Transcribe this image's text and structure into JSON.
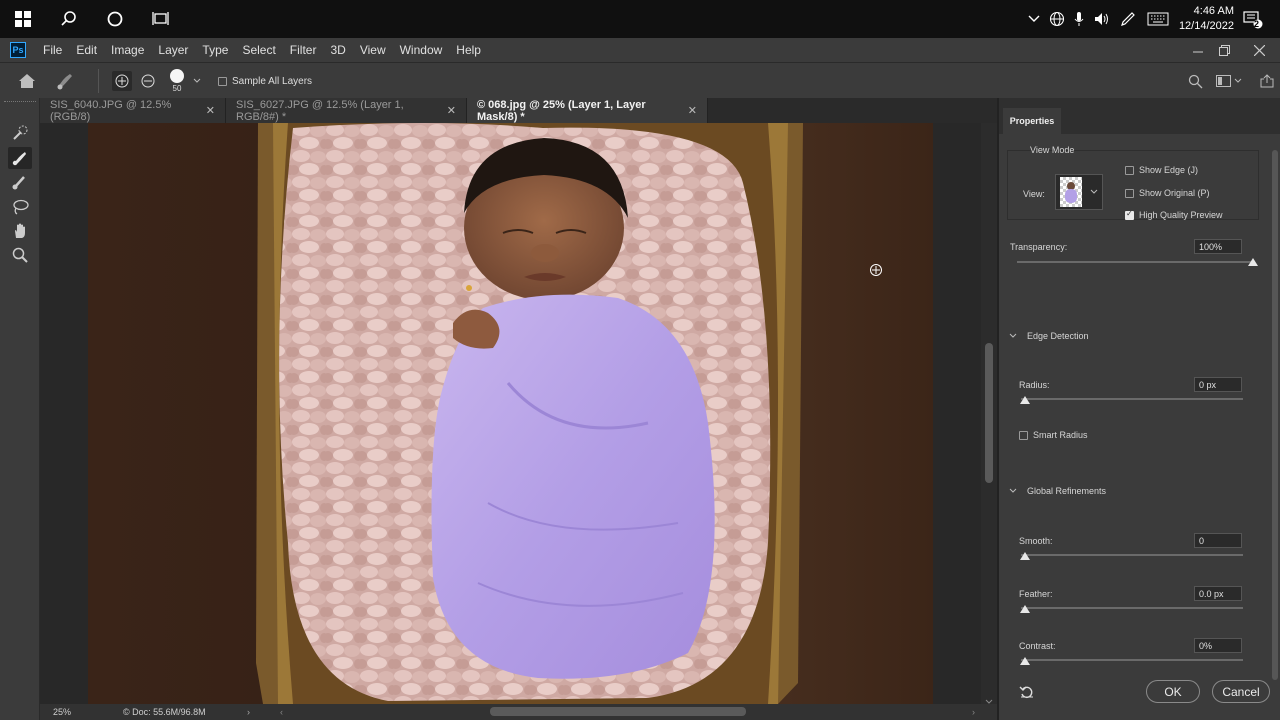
{
  "taskbar": {
    "time": "4:46 AM",
    "date": "12/14/2022",
    "notifications": "2"
  },
  "menu": {
    "logo": "Ps",
    "items": [
      "File",
      "Edit",
      "Image",
      "Layer",
      "Type",
      "Select",
      "Filter",
      "3D",
      "View",
      "Window",
      "Help"
    ]
  },
  "options": {
    "brush_size": "50",
    "sample_all_layers": "Sample All Layers",
    "sample_all_layers_checked": false
  },
  "tabs": [
    {
      "label": "SIS_6040.JPG @ 12.5% (RGB/8)",
      "active": false
    },
    {
      "label": "SIS_6027.JPG @ 12.5% (Layer 1, RGB/8#) *",
      "active": false
    },
    {
      "label": "© 068.jpg @ 25% (Layer 1, Layer Mask/8) *",
      "active": true
    }
  ],
  "status": {
    "zoom": "25%",
    "doc": "© Doc: 55.6M/96.8M"
  },
  "properties": {
    "title": "Properties",
    "view_mode_label": "View Mode",
    "view_label": "View:",
    "show_edge": "Show Edge (J)",
    "show_edge_checked": false,
    "show_original": "Show Original (P)",
    "show_original_checked": false,
    "hq_preview": "High Quality Preview",
    "hq_preview_checked": true,
    "transparency_label": "Transparency:",
    "transparency_value": "100%",
    "transparency_level": 1.0,
    "edge_detection_label": "Edge Detection",
    "radius_label": "Radius:",
    "radius_value": "0 px",
    "smart_radius": "Smart Radius",
    "smart_radius_checked": false,
    "global_refinements_label": "Global Refinements",
    "smooth_label": "Smooth:",
    "smooth_value": "0",
    "feather_label": "Feather:",
    "feather_value": "0.0 px",
    "contrast_label": "Contrast:",
    "contrast_value": "0%",
    "ok": "OK",
    "cancel": "Cancel"
  }
}
